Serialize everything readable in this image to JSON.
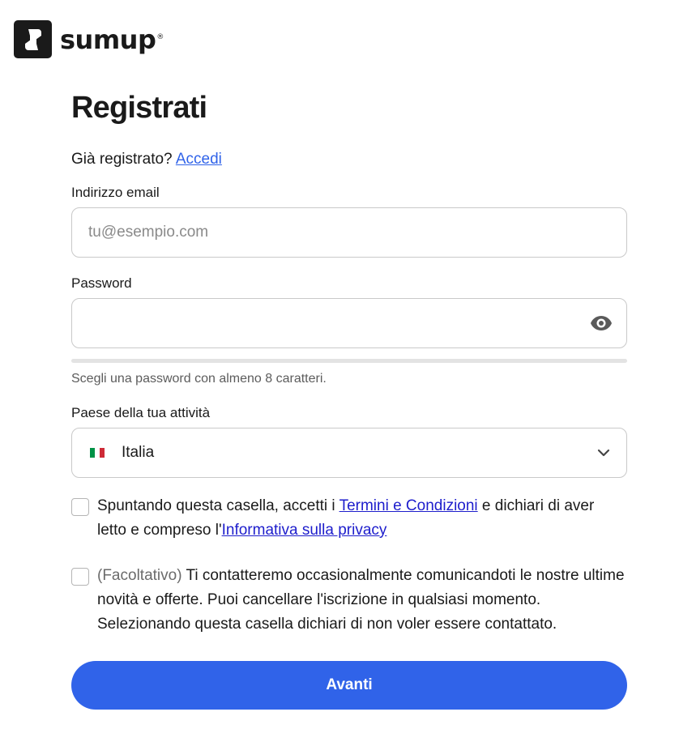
{
  "brand": {
    "name": "sumup",
    "registered_mark": "®"
  },
  "page": {
    "title": "Registrati"
  },
  "signin": {
    "prompt": "Già registrato?",
    "link": "Accedi"
  },
  "email": {
    "label": "Indirizzo email",
    "placeholder": "tu@esempio.com",
    "value": ""
  },
  "password": {
    "label": "Password",
    "value": "",
    "hint": "Scegli una password con almeno 8 caratteri.",
    "toggle_icon": "eye-icon"
  },
  "country": {
    "label": "Paese della tua attività",
    "value": "Italia",
    "flag": "it-flag-icon"
  },
  "terms": {
    "checked": false,
    "text_before": "Spuntando questa casella, accetti i ",
    "terms_link": "Termini e Condizioni",
    "text_middle": " e dichiari di aver letto e compreso l'",
    "privacy_link": "Informativa sulla privacy"
  },
  "marketing": {
    "checked": false,
    "optional_tag": "(Facoltativo)",
    "text": " Ti contatteremo occasionalmente comunicandoti le nostre ultime novità e offerte. Puoi cancellare l'iscrizione in qualsiasi momento. Selezionando questa casella dichiari di non voler essere contattato."
  },
  "submit": {
    "label": "Avanti"
  },
  "colors": {
    "accent": "#3063e9",
    "link": "#1d1dcc",
    "text": "#1a1a1a",
    "border": "#c9c9c9"
  }
}
